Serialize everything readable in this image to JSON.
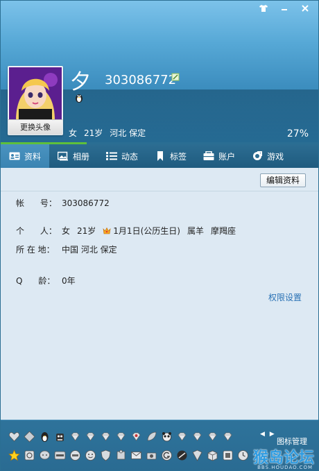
{
  "window": {
    "buttons": [
      {
        "name": "skin-button",
        "glyph": "👕"
      },
      {
        "name": "minimize-button",
        "glyph": "—"
      },
      {
        "name": "close-button",
        "glyph": "✕"
      }
    ]
  },
  "profile": {
    "change_avatar_label": "更换头像",
    "nickname": "夕",
    "qq_number": "303086772",
    "gender": "女",
    "age": "21岁",
    "location": "河北 保定",
    "completion": "27%",
    "completion_value": 0.27
  },
  "tabs": [
    {
      "label": "资料",
      "icon": "profile-card-icon",
      "active": true
    },
    {
      "label": "相册",
      "icon": "photo-album-icon",
      "active": false
    },
    {
      "label": "动态",
      "icon": "feed-list-icon",
      "active": false
    },
    {
      "label": "标签",
      "icon": "bookmark-tag-icon",
      "active": false
    },
    {
      "label": "账户",
      "icon": "wallet-icon",
      "active": false
    },
    {
      "label": "游戏",
      "icon": "game-icon",
      "active": false
    }
  ],
  "details": {
    "edit_button": "编辑资料",
    "account_label": "帐      号：",
    "account_value": "303086772",
    "personal_label": "个      人：",
    "personal_gender": "女",
    "personal_age": "21岁",
    "birthday": "1月1日(公历生日)",
    "zodiac": "属羊",
    "constellation": "摩羯座",
    "location_label": "所 在 地：",
    "location_value": "中国 河北 保定",
    "qage_label": "Q      龄：",
    "qage_value": "0年",
    "permission_link": "权限设置"
  },
  "iconbar": {
    "manage_label": "图标管理",
    "arrows": "◀ ▶",
    "watermark": "猴岛论坛",
    "watermark_url": "BBS.HOUDAO.COM",
    "row1_icons": [
      "heart-icon",
      "diamond-icon",
      "penguin-icon",
      "pet-icon",
      "gem-icon",
      "gem-icon",
      "gem-icon",
      "gem-icon",
      "heart-gem-icon",
      "leaf-icon",
      "panda-icon",
      "gem-icon",
      "gem-icon",
      "gem-icon",
      "gem-icon"
    ],
    "row2_icons": [
      "star-icon",
      "photo-icon",
      "chat-icon",
      "app-icon",
      "cf-icon",
      "face-icon",
      "shield-icon",
      "puzzle-icon",
      "mail-icon",
      "camera-icon",
      "g-icon",
      "stroke-icon",
      "guard-icon",
      "box-icon",
      "qzone-icon",
      "clock-icon"
    ]
  }
}
